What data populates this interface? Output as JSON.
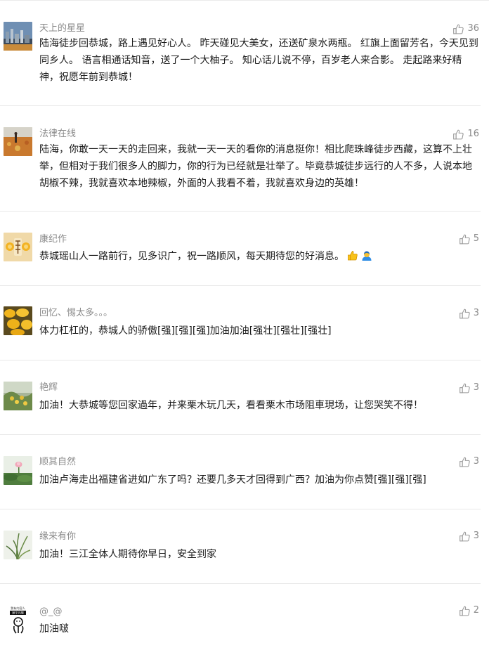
{
  "comments": [
    {
      "nickname": "天上的星星",
      "likes": "36",
      "text": "陆海徒步回恭城，路上遇见好心人。 昨天碰见大美女，还送矿泉水两瓶。 红旗上面留芳名，今天见到同乡人。 语言相通话知音，送了一个大柚子。 知心话儿说不停，百岁老人来合影。 走起路来好精神，祝愿年前到恭城！"
    },
    {
      "nickname": "法律在线",
      "likes": "16",
      "text": "陆海，你敢一天一天的走回来，我就一天一天的看你的消息挺你！相比爬珠峰徒步西藏，这算不上壮举，但相对于我们很多人的脚力，你的行为已经就是壮举了。毕竟恭城徒步远行的人不多，人说本地胡椒不辣，我就喜欢本地辣椒，外面的人我看不着，我就喜欢身边的英雄！"
    },
    {
      "nickname": "康纪作",
      "likes": "5",
      "text": "恭城瑶山人一路前行，见多识广，祝一路顺风，每天期待您的好消息。"
    },
    {
      "nickname": "回忆、惕太多。。。",
      "likes": "3",
      "text": "体力杠杠的，恭城人的骄傲[强][强][强]加油加油[强壮][强壮][强壮]"
    },
    {
      "nickname": "艳辉",
      "likes": "3",
      "text": "加油！大恭城等您回家過年，并来栗木玩几天，看看栗木市场阻車現场，让您哭笑不得！"
    },
    {
      "nickname": "顺其自然",
      "likes": "3",
      "text": "加油卢海走出福建省进如广东了吗？还要几多天才回得到广西？加油为你点赞[强][强][强]"
    },
    {
      "nickname": "缘来有你",
      "likes": "3",
      "text": "加油！三江全体人期待你早日，安全到家"
    },
    {
      "nickname": "@_@",
      "likes": "2",
      "text": "加油啵"
    }
  ],
  "avatar_logo_text": [
    "我有内容人",
    "很平凡哦"
  ],
  "icons": {
    "like": "thumbs-up-icon",
    "emoji_1": "thumbs-up-emoji-icon",
    "emoji_2": "person-emoji-icon"
  },
  "colors": {
    "meta_text": "#8a8a8a",
    "body_text": "#1a1a1a",
    "divider": "#e8e8e8"
  }
}
